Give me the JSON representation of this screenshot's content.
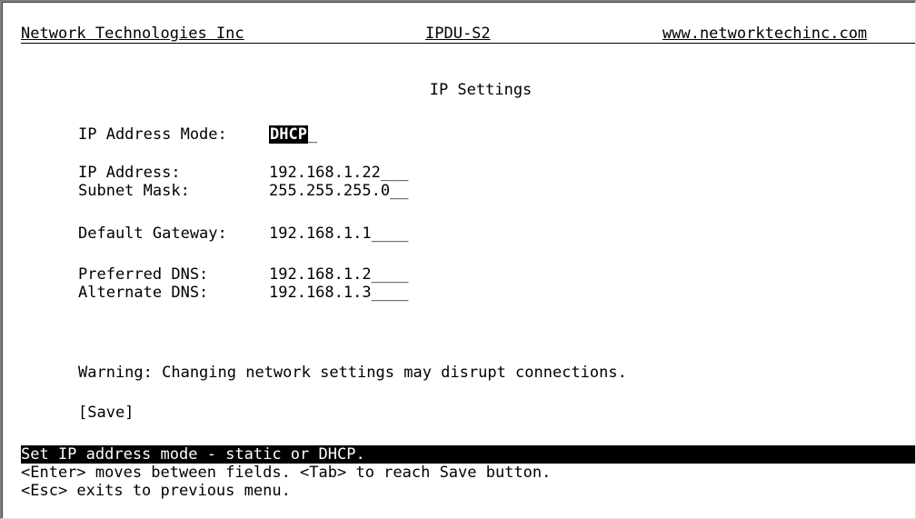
{
  "header": {
    "company": "Network Technologies Inc",
    "model": "IPDU-S2",
    "website": "www.networktechinc.com"
  },
  "page_title": "IP Settings",
  "fields": {
    "ip_mode": {
      "label": "IP Address Mode:",
      "value": "DHCP",
      "blank": "_"
    },
    "ip_address": {
      "label": "IP Address:",
      "value": "192.168.1.22",
      "blank": "___"
    },
    "subnet_mask": {
      "label": "Subnet Mask:",
      "value": "255.255.255.0",
      "blank": "__"
    },
    "gateway": {
      "label": "Default Gateway:",
      "value": "192.168.1.1",
      "blank": "____"
    },
    "preferred_dns": {
      "label": "Preferred DNS:",
      "value": "192.168.1.2",
      "blank": "____"
    },
    "alternate_dns": {
      "label": "Alternate DNS:",
      "value": "192.168.1.3",
      "blank": "____"
    }
  },
  "warning": "Warning: Changing network settings may disrupt connections.",
  "save_button": "[Save]",
  "status": "Set IP address mode - static or DHCP.",
  "help": {
    "line1": "<Enter> moves between fields. <Tab> to reach Save button.",
    "line2": "<Esc> exits to previous menu."
  }
}
